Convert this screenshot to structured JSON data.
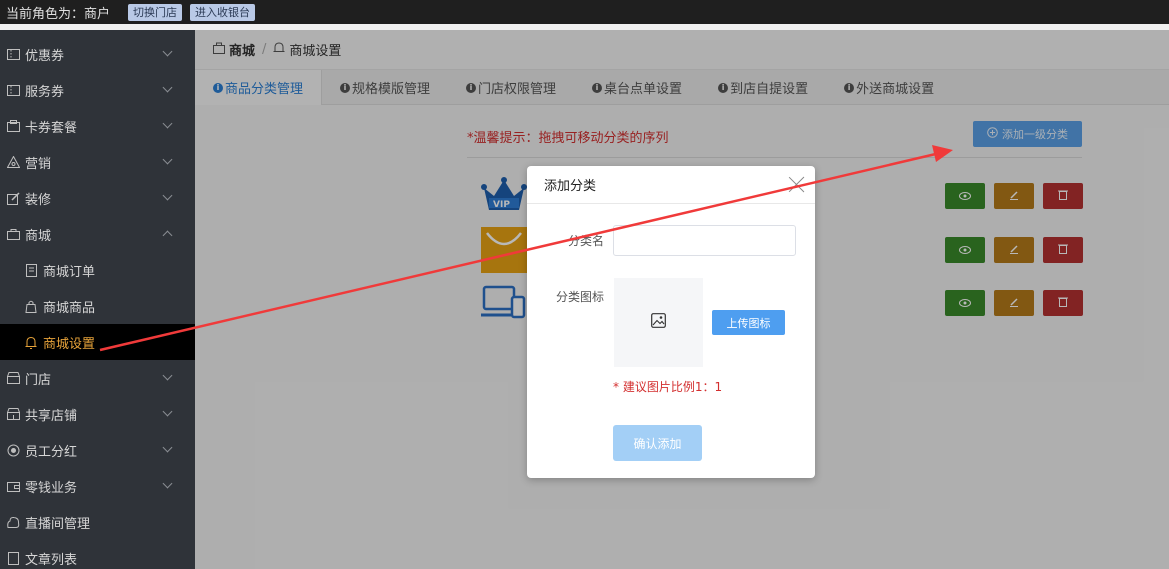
{
  "topbar": {
    "role_text": "当前角色为：商户",
    "switch_store": "切换门店",
    "enter_cashier": "进入收银台"
  },
  "sidebar": {
    "items": [
      {
        "label": "优惠券",
        "icon": "ticket-icon"
      },
      {
        "label": "服务券",
        "icon": "ticket-icon"
      },
      {
        "label": "卡券套餐",
        "icon": "card-icon"
      },
      {
        "label": "营销",
        "icon": "marketing-icon"
      },
      {
        "label": "装修",
        "icon": "edit-icon"
      },
      {
        "label": "商城",
        "icon": "shop-icon"
      },
      {
        "label": "商城订单",
        "icon": "order-icon"
      },
      {
        "label": "商城商品",
        "icon": "bag-icon"
      },
      {
        "label": "商城设置",
        "icon": "bell-icon"
      },
      {
        "label": "门店",
        "icon": "store-icon"
      },
      {
        "label": "共享店铺",
        "icon": "shared-store-icon"
      },
      {
        "label": "员工分红",
        "icon": "bonus-icon"
      },
      {
        "label": "零钱业务",
        "icon": "wallet-icon"
      },
      {
        "label": "直播间管理",
        "icon": "live-icon"
      },
      {
        "label": "文章列表",
        "icon": "article-icon"
      }
    ]
  },
  "breadcrumb": {
    "first": "商城",
    "sep": "/",
    "second": "商城设置"
  },
  "tabs": [
    {
      "label": "商品分类管理"
    },
    {
      "label": "规格模版管理"
    },
    {
      "label": "门店权限管理"
    },
    {
      "label": "桌台点单设置"
    },
    {
      "label": "到店自提设置"
    },
    {
      "label": "外送商城设置"
    }
  ],
  "content": {
    "tip": "*温馨提示：拖拽可移动分类的序列",
    "add_button": "添加一级分类",
    "rows": [
      {
        "icon": "vip-crown-icon"
      },
      {
        "icon": "basket-icon"
      },
      {
        "icon": "devices-icon"
      }
    ]
  },
  "modal": {
    "title": "添加分类",
    "name_label": "分类名",
    "icon_label": "分类图标",
    "upload_button": "上传图标",
    "hint": "* 建议图片比例1：1",
    "confirm_button": "确认添加"
  },
  "colors": {
    "accent": "#2a7fd4",
    "active_menu": "#e7a33a",
    "warning": "#d32f2f"
  }
}
